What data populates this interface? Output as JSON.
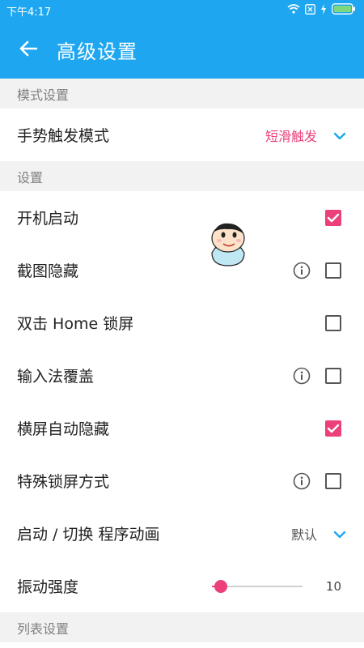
{
  "status_bar": {
    "time": "下午4:17"
  },
  "app_bar": {
    "title": "高级设置"
  },
  "sections": {
    "mode": "模式设置",
    "settings": "设置",
    "list": "列表设置"
  },
  "gesture": {
    "label": "手势触发模式",
    "value": "短滑触发"
  },
  "settings": {
    "boot_start": {
      "label": "开机启动",
      "checked": true
    },
    "screenshot_hide": {
      "label": "截图隐藏",
      "checked": false
    },
    "double_tap_lock": {
      "label": "双击 Home 锁屏",
      "checked": false
    },
    "ime_cover": {
      "label": "输入法覆盖",
      "checked": false
    },
    "landscape_hide": {
      "label": "横屏自动隐藏",
      "checked": true
    },
    "special_lock": {
      "label": "特殊锁屏方式",
      "checked": false
    }
  },
  "animation": {
    "label": "启动 / 切换 程序动画",
    "value": "默认"
  },
  "vibration": {
    "label": "振动强度",
    "value": "10",
    "fraction": 0.1
  },
  "colors": {
    "accent": "#1ea7f0",
    "pink": "#ec407a"
  }
}
